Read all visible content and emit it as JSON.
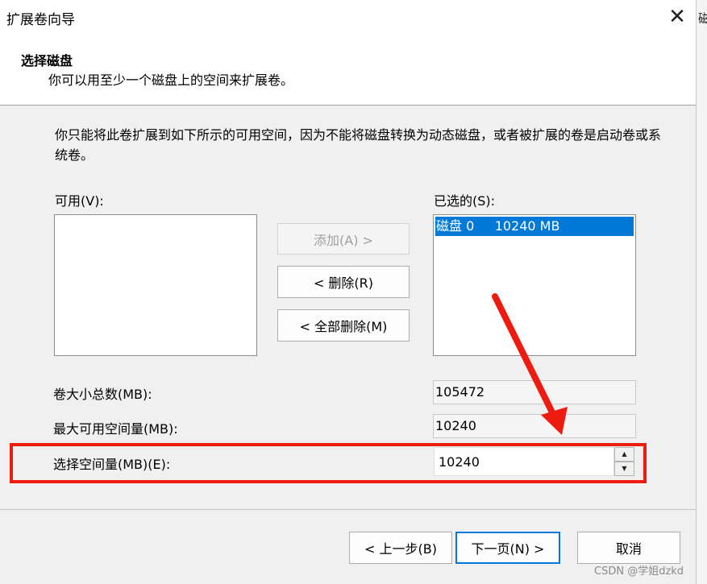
{
  "window": {
    "title": "扩展卷向导",
    "close_glyph": "✕",
    "peek_text": "磁"
  },
  "header": {
    "title": "选择磁盘",
    "subtitle": "你可以用至少一个磁盘上的空间来扩展卷。"
  },
  "description": "你只能将此卷扩展到如下所示的可用空间，因为不能将磁盘转换为动态磁盘，或者被扩展的卷是启动卷或系统卷。",
  "available": {
    "label": "可用(V):",
    "items": []
  },
  "selected": {
    "label": "已选的(S):",
    "items": [
      {
        "text": "磁盘 0     10240 MB"
      }
    ]
  },
  "buttons": {
    "add": "添加(A) >",
    "remove": "< 删除(R)",
    "remove_all": "< 全部删除(M)"
  },
  "fields": {
    "total_label": "卷大小总数(MB):",
    "total_value": "105472",
    "max_label": "最大可用空间量(MB):",
    "max_value": "10240",
    "select_label": "选择空间量(MB)(E):",
    "select_value": "10240"
  },
  "spinner": {
    "up": "▲",
    "down": "▼"
  },
  "nav": {
    "back": "< 上一步(B)",
    "next": "下一页(N) >",
    "cancel": "取消"
  },
  "watermark": "CSDN @学姐dzkd",
  "colors": {
    "selection": "#0078d7",
    "annotation": "#ee1c10"
  }
}
